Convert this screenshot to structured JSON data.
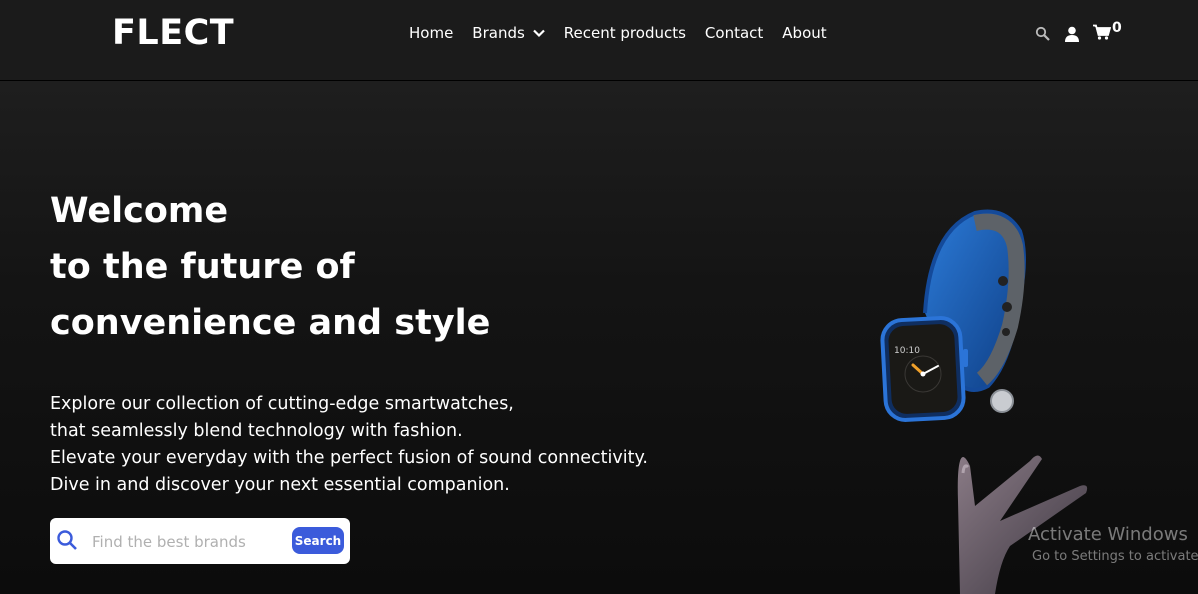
{
  "brand": {
    "logo": "FLECT"
  },
  "nav": {
    "items": [
      {
        "label": "Home"
      },
      {
        "label": "Brands"
      },
      {
        "label": "Recent products"
      },
      {
        "label": "Contact"
      },
      {
        "label": "About"
      }
    ],
    "cart_count": "0",
    "icons": [
      "search-icon",
      "user-icon",
      "cart-icon",
      "chevron-down-icon"
    ]
  },
  "hero": {
    "headline": [
      "Welcome",
      "to the future of",
      "convenience and style"
    ],
    "intro": [
      "Explore our collection of cutting-edge smartwatches,",
      "that seamlessly blend technology with fashion.",
      "Elevate your everyday with the perfect fusion of sound connectivity.",
      "Dive in and discover your next essential companion."
    ],
    "watch_time": "10:10"
  },
  "search": {
    "placeholder": "Find the best brands",
    "button_label": "Search"
  },
  "watermark": {
    "line1": "Activate Windows",
    "line2": "Go to Settings to activate"
  },
  "colors": {
    "accent": "#3b5bdb",
    "background": "#111111",
    "watch_band": "#1e63c8"
  }
}
